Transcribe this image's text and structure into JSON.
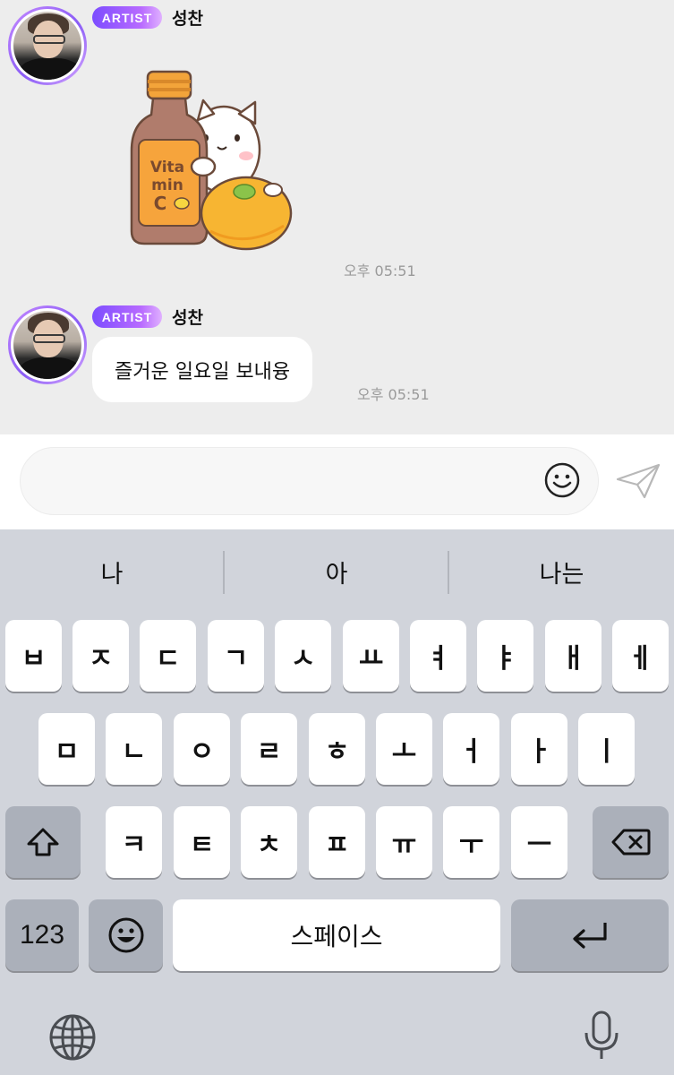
{
  "messages": [
    {
      "badge": "ARTIST",
      "sender": "성찬",
      "type": "sticker",
      "sticker": {
        "bottle_text_line1": "Vita",
        "bottle_text_line2": "min",
        "bottle_text_line3": "C"
      },
      "time": "오후 05:51"
    },
    {
      "badge": "ARTIST",
      "sender": "성찬",
      "type": "text",
      "text": "즐거운 일요일 보내융",
      "time": "오후 05:51"
    }
  ],
  "input": {
    "placeholder": ""
  },
  "keyboard": {
    "suggestions": [
      "나",
      "아",
      "나는"
    ],
    "row1": [
      "ㅂ",
      "ㅈ",
      "ㄷ",
      "ㄱ",
      "ㅅ",
      "ㅛ",
      "ㅕ",
      "ㅑ",
      "ㅐ",
      "ㅔ"
    ],
    "row2": [
      "ㅁ",
      "ㄴ",
      "ㅇ",
      "ㄹ",
      "ㅎ",
      "ㅗ",
      "ㅓ",
      "ㅏ",
      "ㅣ"
    ],
    "row3": [
      "ㅋ",
      "ㅌ",
      "ㅊ",
      "ㅍ",
      "ㅠ",
      "ㅜ",
      "ㅡ"
    ],
    "numbers_label": "123",
    "space_label": "스페이스"
  },
  "colors": {
    "badge_gradient_start": "#7c4dff",
    "badge_gradient_end": "#e0b0ff",
    "chat_background": "#ededed",
    "keyboard_background": "#d1d4db"
  },
  "icons": {
    "emoji": "smiley-icon",
    "send": "paper-plane-icon",
    "shift": "shift-arrow-icon",
    "delete": "backspace-icon",
    "return": "return-arrow-icon",
    "globe": "globe-icon",
    "mic": "microphone-icon"
  }
}
